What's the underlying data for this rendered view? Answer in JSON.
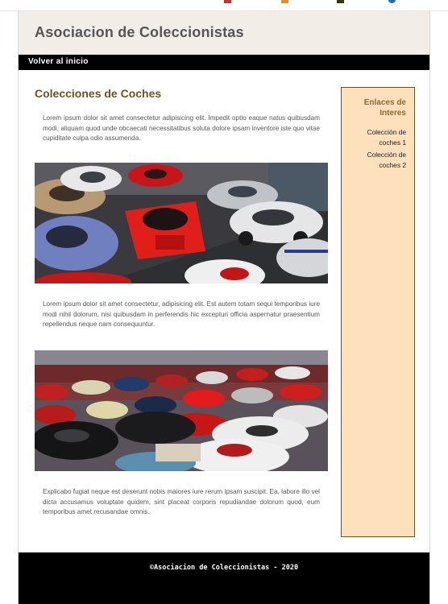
{
  "header": {
    "title": "Asociacion de Coleccionistas"
  },
  "nav": {
    "back_label": "Volver al inicio"
  },
  "main": {
    "section_title": "Colecciones de Coches",
    "paragraphs": [
      "Lorem ipsum dolor sit amet consectetur adipisicing elit. Impedit optio eaque natus quibusdam modi, aliquam quod unde obcaecati necessitatibus soluta dolore ipsam inventore iste quo vitae cupiditate culpa odio assumenda.",
      "Lorem ipsum dolor sit amet consectetur, adipisicing elit. Est autem totam sequi temporibus iure modi nihil dolorum, nisi quibusdam in perferendis hic excepturi officia aspernatur praesentium repellendus neque nam consequuntur.",
      "Explicabo fugiat neque est deserunt nobis maiores iure rerum ipsam suscipit. Ea, labore illo vel dicta accusamus voluptate quidem, sint placeat corporis repudiandae dolorum quod, eum temporibus amet recusandae omnis."
    ]
  },
  "aside": {
    "title": "Enlaces de Interes",
    "links": [
      "Colección de coches 1",
      "Colección de coches 2"
    ]
  },
  "footer": {
    "text": "©Asociacion de Coleccionistas - 2020"
  },
  "colors": {
    "header_bg": "#f3ede8",
    "nav_bg": "#000000",
    "accent_brown": "#6b5224",
    "aside_bg": "#ffe0bc",
    "footer_bg": "#000000"
  }
}
